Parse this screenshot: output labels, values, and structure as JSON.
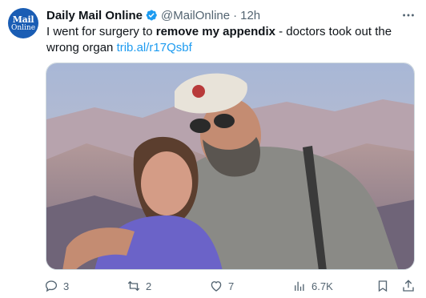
{
  "account": {
    "avatar_line1": "Mail",
    "avatar_line2": "Online",
    "name": "Daily Mail Online",
    "handle": "@MailOnline",
    "separator": "·",
    "time": "12h"
  },
  "tweet": {
    "text_before": "I went for surgery to ",
    "text_bold": "remove my appendix",
    "text_after": " - doctors took out the wrong organ ",
    "link": "trib.al/r17Qsbf"
  },
  "media": {
    "description_icon": "photo-couple-canyon"
  },
  "actions": {
    "replies": "3",
    "reposts": "2",
    "likes": "7",
    "views": "6.7K"
  },
  "icons": [
    "verified-badge-icon",
    "more-icon",
    "reply-icon",
    "repost-icon",
    "like-icon",
    "views-icon",
    "bookmark-icon",
    "share-icon"
  ],
  "colors": {
    "accent": "#1d9bf0",
    "muted": "#536471",
    "avatar_bg": "#1a5db4"
  }
}
